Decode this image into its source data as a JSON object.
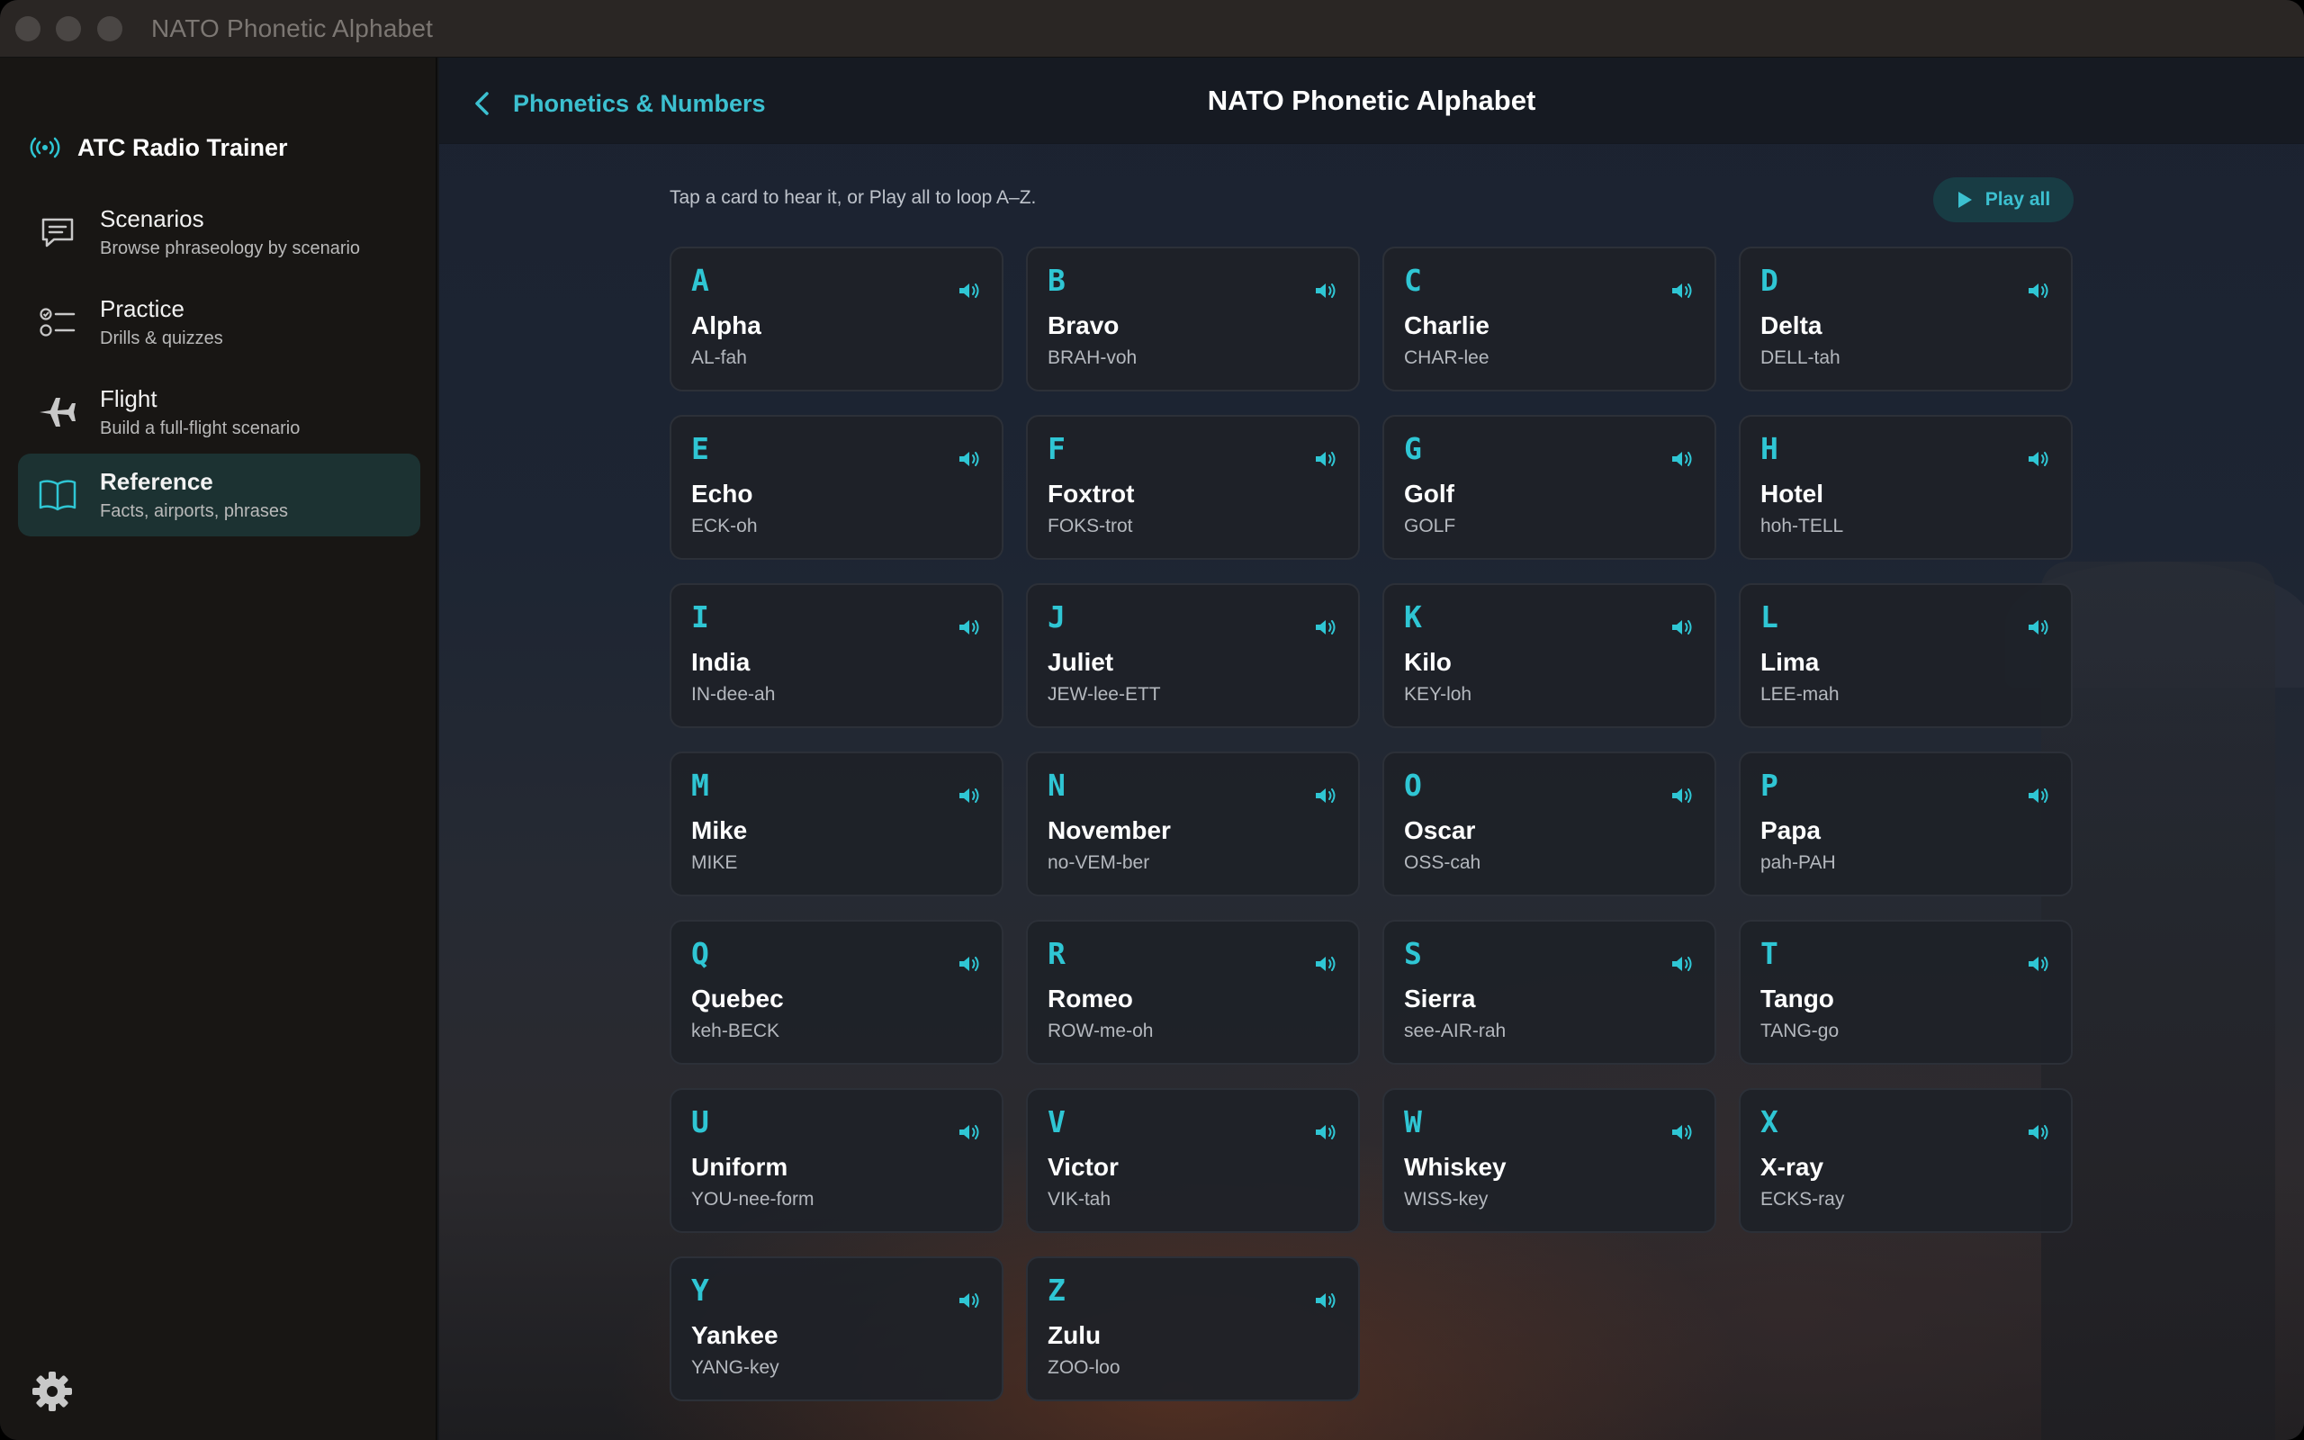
{
  "window": {
    "title": "NATO Phonetic Alphabet"
  },
  "sidebar": {
    "brand": "ATC Radio Trainer",
    "items": [
      {
        "title": "Scenarios",
        "subtitle": "Browse phraseology by scenario",
        "icon": "chat-bubble-icon",
        "active": false
      },
      {
        "title": "Practice",
        "subtitle": "Drills & quizzes",
        "icon": "checklist-icon",
        "active": false
      },
      {
        "title": "Flight",
        "subtitle": "Build a full-flight scenario",
        "icon": "airplane-icon",
        "active": false
      },
      {
        "title": "Reference",
        "subtitle": "Facts, airports, phrases",
        "icon": "book-icon",
        "active": true
      }
    ],
    "settings_icon": "gear-icon"
  },
  "header": {
    "back_label": "Phonetics & Numbers",
    "title": "NATO Phonetic Alphabet"
  },
  "content": {
    "hint": "Tap a card to hear it, or Play all to loop A–Z.",
    "play_all_label": "Play all",
    "accent_color": "#2fc6d4",
    "cards": [
      {
        "letter": "A",
        "word": "Alpha",
        "pron": "AL-fah"
      },
      {
        "letter": "B",
        "word": "Bravo",
        "pron": "BRAH-voh"
      },
      {
        "letter": "C",
        "word": "Charlie",
        "pron": "CHAR-lee"
      },
      {
        "letter": "D",
        "word": "Delta",
        "pron": "DELL-tah"
      },
      {
        "letter": "E",
        "word": "Echo",
        "pron": "ECK-oh"
      },
      {
        "letter": "F",
        "word": "Foxtrot",
        "pron": "FOKS-trot"
      },
      {
        "letter": "G",
        "word": "Golf",
        "pron": "GOLF"
      },
      {
        "letter": "H",
        "word": "Hotel",
        "pron": "hoh-TELL"
      },
      {
        "letter": "I",
        "word": "India",
        "pron": "IN-dee-ah"
      },
      {
        "letter": "J",
        "word": "Juliet",
        "pron": "JEW-lee-ETT"
      },
      {
        "letter": "K",
        "word": "Kilo",
        "pron": "KEY-loh"
      },
      {
        "letter": "L",
        "word": "Lima",
        "pron": "LEE-mah"
      },
      {
        "letter": "M",
        "word": "Mike",
        "pron": "MIKE"
      },
      {
        "letter": "N",
        "word": "November",
        "pron": "no-VEM-ber"
      },
      {
        "letter": "O",
        "word": "Oscar",
        "pron": "OSS-cah"
      },
      {
        "letter": "P",
        "word": "Papa",
        "pron": "pah-PAH"
      },
      {
        "letter": "Q",
        "word": "Quebec",
        "pron": "keh-BECK"
      },
      {
        "letter": "R",
        "word": "Romeo",
        "pron": "ROW-me-oh"
      },
      {
        "letter": "S",
        "word": "Sierra",
        "pron": "see-AIR-rah"
      },
      {
        "letter": "T",
        "word": "Tango",
        "pron": "TANG-go"
      },
      {
        "letter": "U",
        "word": "Uniform",
        "pron": "YOU-nee-form"
      },
      {
        "letter": "V",
        "word": "Victor",
        "pron": "VIK-tah"
      },
      {
        "letter": "W",
        "word": "Whiskey",
        "pron": "WISS-key"
      },
      {
        "letter": "X",
        "word": "X-ray",
        "pron": "ECKS-ray"
      },
      {
        "letter": "Y",
        "word": "Yankee",
        "pron": "YANG-key"
      },
      {
        "letter": "Z",
        "word": "Zulu",
        "pron": "ZOO-loo"
      }
    ]
  }
}
